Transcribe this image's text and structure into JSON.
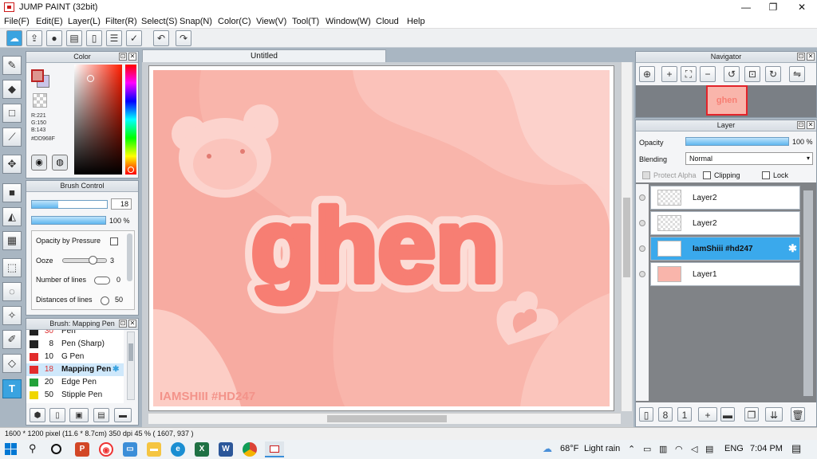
{
  "window": {
    "title": "JUMP PAINT (32bit)",
    "minimize": "—",
    "maximize": "❐",
    "close": "✕"
  },
  "menu": [
    "File(F)",
    "Edit(E)",
    "Layer(L)",
    "Filter(R)",
    "Select(S)",
    "Snap(N)",
    "Color(C)",
    "View(V)",
    "Tool(T)",
    "Window(W)",
    "Cloud",
    "Help"
  ],
  "toolbar": {
    "undo": "↶",
    "redo": "↷"
  },
  "document": {
    "tab": "Untitled"
  },
  "color_panel": {
    "title": "Color",
    "r": "R:221",
    "g": "G:150",
    "b": "B:143",
    "hex": "#DD968F",
    "main_color": "#dd968f"
  },
  "brush_control": {
    "title": "Brush Control",
    "size": "18",
    "size_fill": 0.35,
    "opacity": "100 %",
    "opacity_fill": 1.0,
    "opacity_by_pressure": "Opacity by Pressure",
    "ooze_label": "Ooze",
    "ooze_value": "3",
    "ooze_level": 0.6,
    "lines_label": "Number of lines",
    "lines_value": "0",
    "distances_label": "Distances of lines",
    "distances_value": "50"
  },
  "brush_list": {
    "title": "Brush: Mapping Pen",
    "items": [
      {
        "size": "30",
        "name": "Pen",
        "color": "#222222"
      },
      {
        "size": "8",
        "name": "Pen (Sharp)",
        "color": "#222222"
      },
      {
        "size": "10",
        "name": "G Pen",
        "color": "#e22c2c"
      },
      {
        "size": "18",
        "name": "Mapping Pen",
        "color": "#e22c2c"
      },
      {
        "size": "20",
        "name": "Edge Pen",
        "color": "#23a23a"
      },
      {
        "size": "50",
        "name": "Stipple Pen",
        "color": "#f0d600"
      }
    ]
  },
  "canvas": {
    "title_art": "ghen",
    "watermark": "IAMSHIII #HD247",
    "bg": "#f9b5ab"
  },
  "navigator": {
    "title": "Navigator",
    "thumb_text": "ghen"
  },
  "layer_panel": {
    "title": "Layer",
    "opacity_label": "Opacity",
    "opacity_value": "100 %",
    "opacity_fill": 1.0,
    "blending_label": "Blending",
    "blending_value": "Normal",
    "protect_alpha": "Protect Alpha",
    "clipping": "Clipping",
    "lock": "Lock",
    "layers": [
      {
        "name": "Layer2"
      },
      {
        "name": "Layer2"
      },
      {
        "name": "IamShiii #hd247"
      },
      {
        "name": "Layer1"
      }
    ]
  },
  "statusbar": {
    "text": "1600 * 1200 pixel  (11.6 * 8.7cm)  350 dpi  45 %  ( 1607, 937 )"
  },
  "taskbar": {
    "temp": "68°F",
    "weather": "Light rain",
    "lang": "ENG",
    "time": "7:04 PM"
  }
}
